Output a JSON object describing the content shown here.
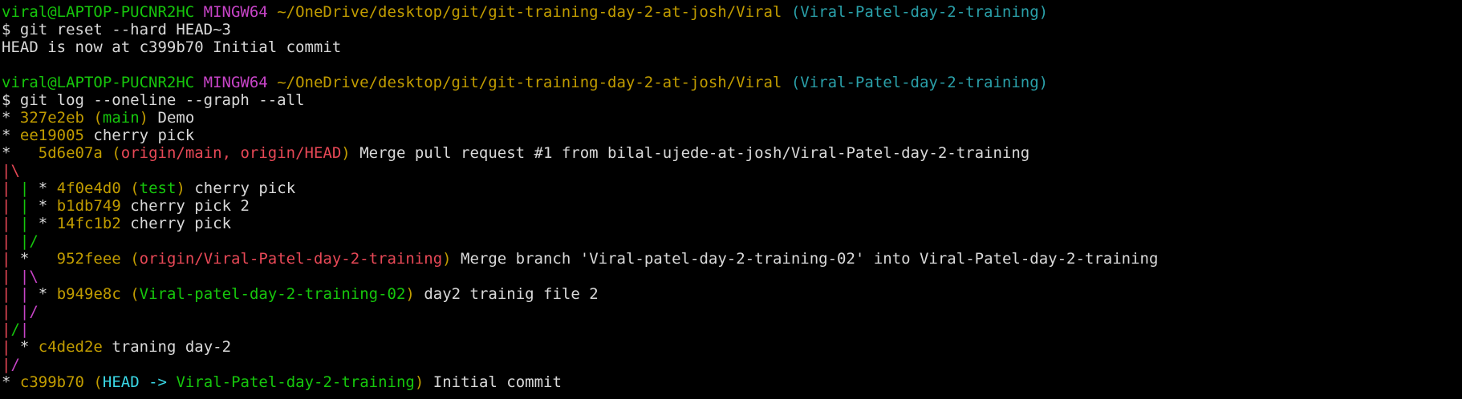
{
  "terminal": {
    "prompt1": {
      "user": "viral@LAPTOP-PUCNR2HC",
      "system": "MINGW64",
      "path": "~/OneDrive/desktop/git/git-training-day-2-at-josh/Viral",
      "branch": "(Viral-Patel-day-2-training)"
    },
    "command1": "$ git reset --hard HEAD~3",
    "output1": "HEAD is now at c399b70 Initial commit",
    "prompt2": {
      "user": "viral@LAPTOP-PUCNR2HC",
      "system": "MINGW64",
      "path": "~/OneDrive/desktop/git/git-training-day-2-at-josh/Viral",
      "branch": "(Viral-Patel-day-2-training)"
    },
    "command2": "$ git log --oneline --graph --all",
    "graph": {
      "c1": {
        "hash": "327e2eb",
        "refs_head": "main",
        "msg": "Demo"
      },
      "c2": {
        "hash": "ee19005",
        "msg": "cherry pick"
      },
      "c3": {
        "hash": "5d6e07a",
        "refs": "origin/main, origin/HEAD",
        "msg": "Merge pull request #1 from bilal-ujede-at-josh/Viral-Patel-day-2-training"
      },
      "c4": {
        "hash": "4f0e4d0",
        "refs": "test",
        "msg": "cherry pick"
      },
      "c5": {
        "hash": "b1db749",
        "msg": "cherry pick 2"
      },
      "c6": {
        "hash": "14fc1b2",
        "msg": "cherry pick"
      },
      "c7": {
        "hash": "952feee",
        "refs": "origin/Viral-Patel-day-2-training",
        "msg": "Merge branch 'Viral-patel-day-2-training-02' into Viral-Patel-day-2-training"
      },
      "c8": {
        "hash": "b949e8c",
        "refs": "Viral-patel-day-2-training-02",
        "msg": "day2 trainig file 2"
      },
      "c9": {
        "hash": "c4ded2e",
        "msg": "traning day-2"
      },
      "c10": {
        "hash": "c399b70",
        "refs_head": "HEAD",
        "refs_arrow": "->",
        "refs_branch": "Viral-Patel-day-2-training",
        "msg": "Initial commit"
      }
    },
    "colors": {
      "background": "#000000",
      "text": "#d9d9d9",
      "green": "#16c60c",
      "purple": "#c744c7",
      "yellow": "#c19c00",
      "cyan": "#2aa0a9",
      "red": "#e74856",
      "bright_cyan": "#3ad8e6"
    }
  }
}
